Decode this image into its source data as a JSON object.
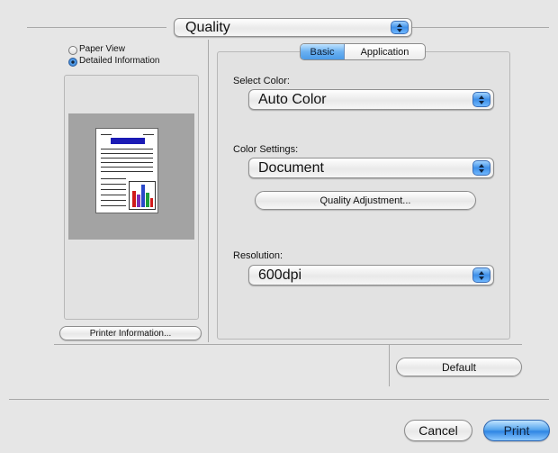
{
  "section_popup": {
    "value": "Quality"
  },
  "view_options": {
    "paper_view_label": "Paper View",
    "detailed_info_label": "Detailed Information",
    "selected": "Detailed Information"
  },
  "tabs": [
    {
      "label": "Basic",
      "selected": true
    },
    {
      "label": "Application",
      "selected": false
    }
  ],
  "select_color": {
    "label": "Select Color:",
    "value": "Auto Color"
  },
  "color_settings": {
    "label": "Color Settings:",
    "value": "Document"
  },
  "quality_adjustment_button": "Quality Adjustment...",
  "resolution": {
    "label": "Resolution:",
    "value": "600dpi"
  },
  "printer_info_button": "Printer Information...",
  "default_button": "Default",
  "cancel_button": "Cancel",
  "print_button": "Print",
  "colors": {
    "accent": "#3e8fe8",
    "window_bg": "#e6e6e6",
    "preview_bg": "#a3a3a3"
  }
}
